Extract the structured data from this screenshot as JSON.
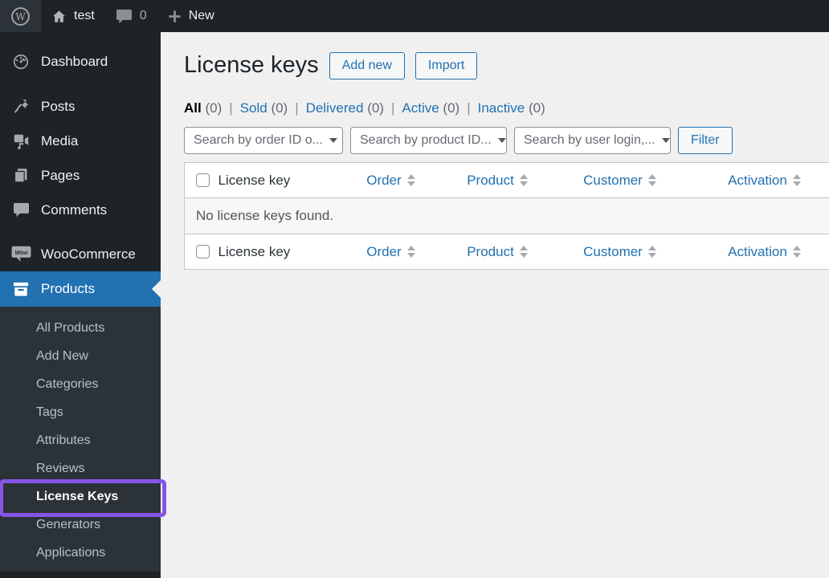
{
  "admin_bar": {
    "site_name": "test",
    "comment_count": "0",
    "new_label": "New"
  },
  "sidebar": {
    "items": [
      {
        "label": "Dashboard"
      },
      {
        "label": "Posts"
      },
      {
        "label": "Media"
      },
      {
        "label": "Pages"
      },
      {
        "label": "Comments"
      },
      {
        "label": "WooCommerce"
      },
      {
        "label": "Products"
      }
    ],
    "woo_badge_text": "Woo",
    "submenu": [
      {
        "label": "All Products"
      },
      {
        "label": "Add New"
      },
      {
        "label": "Categories"
      },
      {
        "label": "Tags"
      },
      {
        "label": "Attributes"
      },
      {
        "label": "Reviews"
      },
      {
        "label": "License Keys"
      },
      {
        "label": "Generators"
      },
      {
        "label": "Applications"
      }
    ]
  },
  "main": {
    "title": "License keys",
    "add_new_label": "Add new",
    "import_label": "Import",
    "filters_separator": "|",
    "filters": [
      {
        "label": "All",
        "count": "(0)"
      },
      {
        "label": "Sold",
        "count": "(0)"
      },
      {
        "label": "Delivered",
        "count": "(0)"
      },
      {
        "label": "Active",
        "count": "(0)"
      },
      {
        "label": "Inactive",
        "count": "(0)"
      }
    ],
    "search": {
      "order_select": "Search by order ID o...",
      "product_select": "Search by product ID...",
      "user_select": "Search by user login,...",
      "filter_button": "Filter"
    },
    "table": {
      "columns": [
        "License key",
        "Order",
        "Product",
        "Customer",
        "Activation"
      ],
      "empty_message": "No license keys found."
    }
  },
  "colors": {
    "admin_blue": "#2271b1",
    "sidebar_bg": "#1d2327",
    "submenu_bg": "#2c3338",
    "content_bg": "#f0f0f1",
    "highlight_purple": "#8655e8"
  }
}
